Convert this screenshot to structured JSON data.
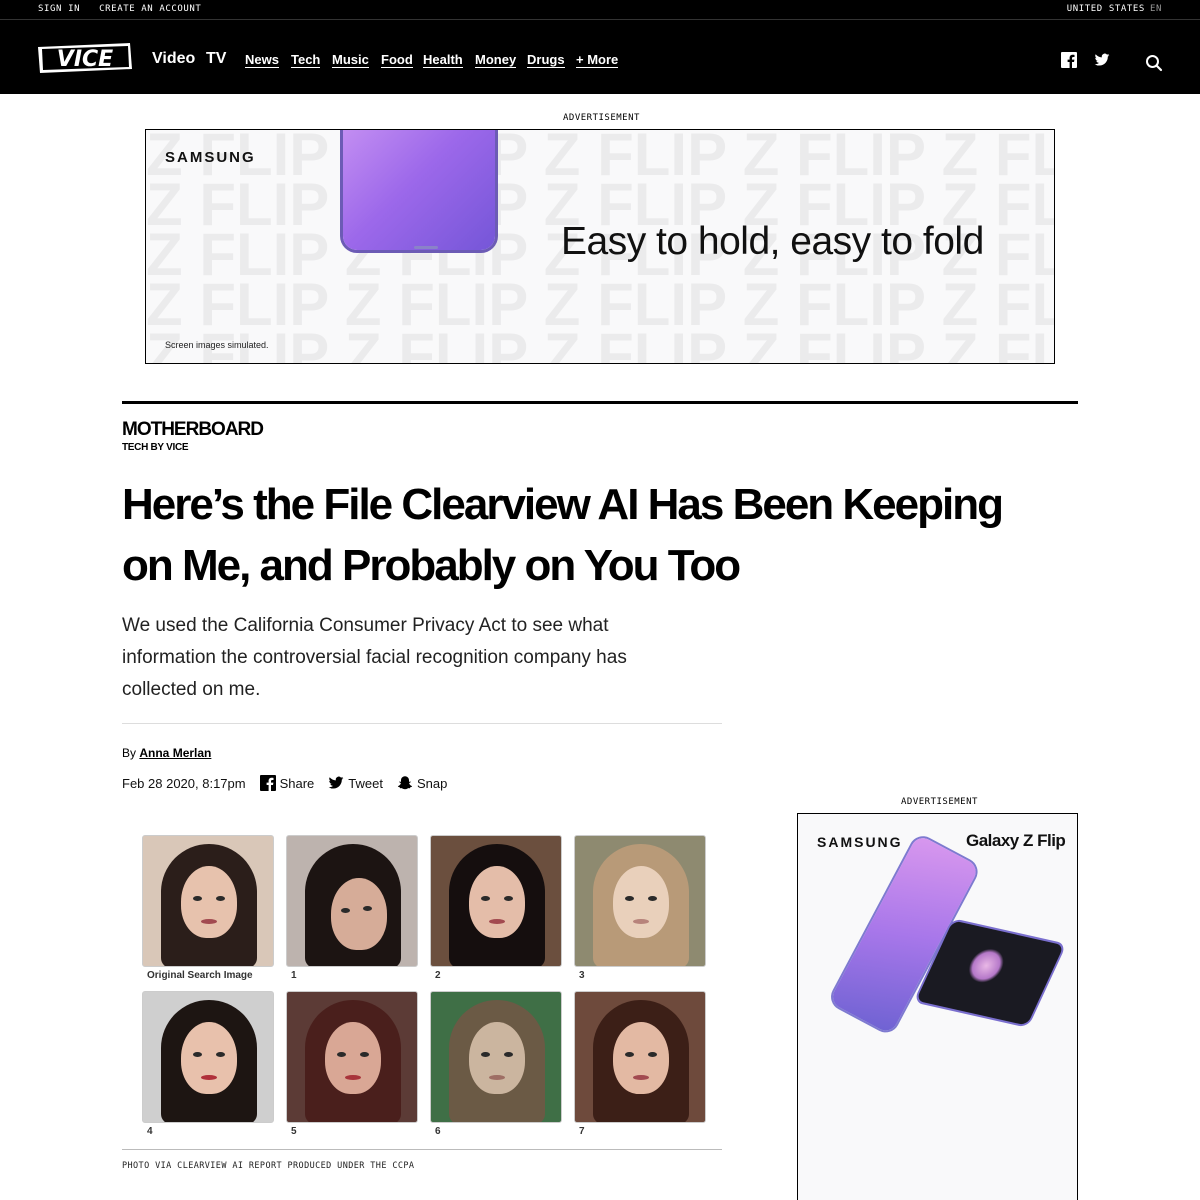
{
  "utility": {
    "sign_in": "SIGN IN",
    "create_account": "CREATE AN ACCOUNT",
    "region": "UNITED STATES",
    "lang": "EN"
  },
  "nav": {
    "logo": "VICE",
    "big": [
      "Video",
      "TV"
    ],
    "items": [
      "News",
      "Tech",
      "Music",
      "Food",
      "Health",
      "Money",
      "Drugs",
      "+ More"
    ],
    "icons": [
      "facebook-icon",
      "twitter-icon",
      "search-icon"
    ]
  },
  "banner_ad": {
    "label": "ADVERTISEMENT",
    "brand": "SAMSUNG",
    "headline": "Easy to hold, easy to fold",
    "note": "Screen images simulated."
  },
  "article": {
    "section": "MOTHERBOARD",
    "section_sub": "TECH BY VICE",
    "title": "Here’s the File Clearview AI Has Been Keeping on Me, and Probably on You Too",
    "dek": "We used the California Consumer Privacy Act to see what information the controversial facial recognition company has collected on me.",
    "by": "By",
    "author": "Anna Merlan",
    "date": "Feb 28 2020, 8:17pm",
    "share": "Share",
    "tweet": "Tweet",
    "snap": "Snap"
  },
  "figure": {
    "labels": [
      "Original Search Image",
      "1",
      "2",
      "3",
      "4",
      "5",
      "6",
      "7"
    ],
    "caption": "PHOTO VIA CLEARVIEW AI REPORT PRODUCED UNDER THE CCPA"
  },
  "side_ad": {
    "label": "ADVERTISEMENT",
    "brand": "SAMSUNG",
    "product": "Galaxy Z Flip"
  },
  "colors": {
    "nav_bg": "#000000",
    "accent_purple": "#9c68ea"
  }
}
